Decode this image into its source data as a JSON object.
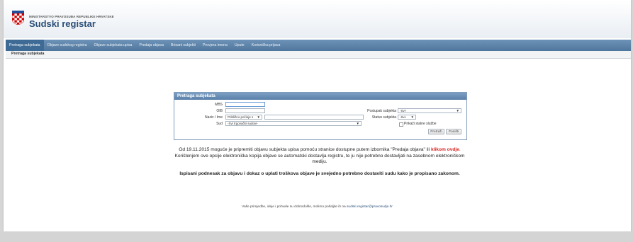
{
  "header": {
    "ministry": "MINISTARSTVO PRAVOSUĐA REPUBLIKE HRVATSKE",
    "title": "Sudski registar"
  },
  "nav": {
    "items": [
      "Pretraga subjekata",
      "Objave sudskog registra",
      "Objave subjekata upisa",
      "Predaja objava",
      "Brisani subjekti",
      "Provjera imena",
      "Upute",
      "Korisnička prijava"
    ]
  },
  "breadcrumb": "Pretraga subjekata",
  "form": {
    "title": "Pretraga subjekata",
    "mbs_label": "MBS",
    "oib_label": "OIB",
    "naziv_label": "Naziv / Ime",
    "naziv_mode": "Približno počinje s",
    "sud_label": "Sud",
    "sud_value": "-Svi trgovački sudovi-",
    "postupak_label": "Postupak subjekta",
    "postupak_value": "-Svi-",
    "status_label": "Status subjekta",
    "status_value": "-Svi-",
    "show_branches_label": "Prikaži stalne službe",
    "search_button": "Pretraži",
    "reset_button": "Poništi"
  },
  "notice": {
    "part1": "Od 19.11.2015 moguće je pripremiti objavu subjekta upisa pomoću stranice dostupne putem izbornika \"Predaja objava\" ili ",
    "link": "klikom ovdje",
    "part2": ". Korištenjem ove opcije elektronička kopija objave se automatski dostavlja registru, te ju nije potrebno dostavljati na zasebnom elektroničkom mediju.",
    "bold": "Ispisani podnesak za objavu i dokaz o uplati troškova objave je svejedno potrebno dostaviti sudu kako je propisano zakonom."
  },
  "footer": {
    "text": "Vaše primjedbe, ideje i pohvale su dobrodošle, molimo pošaljite ih na ",
    "email": "sudski.registar@pravosudje.hr"
  }
}
